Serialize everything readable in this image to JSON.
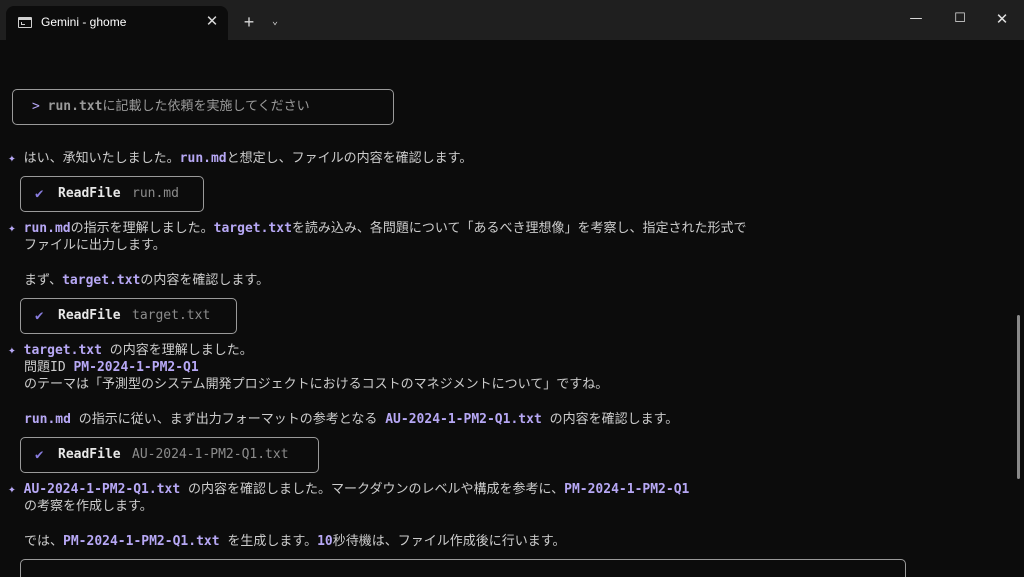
{
  "window": {
    "tab_title": "Gemini - ghome",
    "tab_close": "✕",
    "new_tab": "+",
    "tab_menu": "⌄",
    "minimize": "—",
    "maximize": "☐",
    "close": "✕"
  },
  "terminal": {
    "prompt": {
      "prefix": ">",
      "file": "run.txt",
      "text": "に記載した依頼を実施してください"
    },
    "star": "✦",
    "check": "✔",
    "msg1": {
      "intro": "はい、承知いたしました。",
      "file": "run.md",
      "rest": "と想定し、ファイルの内容を確認します。"
    },
    "tool1": {
      "name": "ReadFile",
      "arg": "run.md"
    },
    "msg2": {
      "file1": "run.md",
      "part1": "の指示を理解しました。",
      "file2": "target.txt",
      "part2": "を読み込み、各問題について「あるべき理想像」を考察し、指定された形式で",
      "line2": "ファイルに出力します。",
      "line3_pre": "まず、",
      "line3_file": "target.txt",
      "line3_post": "の内容を確認します。"
    },
    "tool2": {
      "name": "ReadFile",
      "arg": "target.txt"
    },
    "msg3": {
      "file": "target.txt",
      "part1": " の内容を理解しました。",
      "line2_pre": "問題ID ",
      "line2_id": "PM-2024-1-PM2-Q1",
      "line3": "のテーマは「予測型のシステム開発プロジェクトにおけるコストのマネジメントについて」ですね。",
      "line4_file1": "run.md",
      "line4_mid": " の指示に従い、まず出力フォーマットの参考となる ",
      "line4_file2": "AU-2024-1-PM2-Q1.txt",
      "line4_post": " の内容を確認します。"
    },
    "tool3": {
      "name": "ReadFile",
      "arg": "AU-2024-1-PM2-Q1.txt"
    },
    "msg4": {
      "file1": "AU-2024-1-PM2-Q1.txt",
      "part1": " の内容を確認しました。マークダウンのレベルや構成を参考に、",
      "id": "PM-2024-1-PM2-Q1",
      "line2": "の考察を作成します。",
      "line3_pre": "では、",
      "line3_file": "PM-2024-1-PM2-Q1.txt",
      "line3_mid": " を生成します。",
      "line3_num": "10",
      "line3_post": "秒待機は、ファイル作成後に行います。"
    }
  }
}
